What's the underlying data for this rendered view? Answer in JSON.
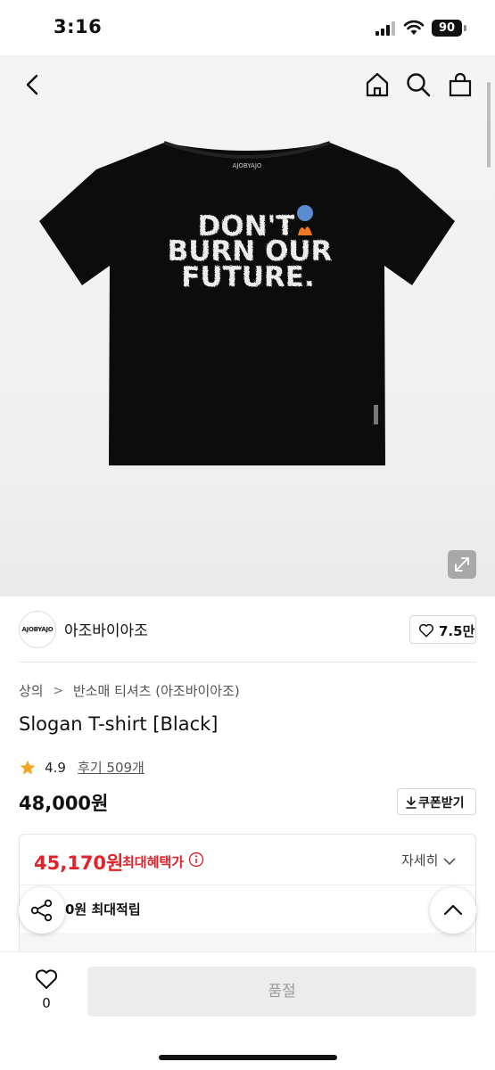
{
  "status_bar": {
    "time": "3:16",
    "battery": "90"
  },
  "nav": {
    "back_icon": "chevron-left-icon",
    "home_icon": "home-icon",
    "search_icon": "search-icon",
    "bag_icon": "shopping-bag-icon"
  },
  "product_image": {
    "label_tag": "AJOBYAJO",
    "slogan_lines": [
      "DON'T",
      "BURN OUR",
      "FUTURE."
    ],
    "expand_icon": "expand-icon"
  },
  "brand": {
    "logo_text": "AJOBYAJO",
    "name": "아조바이아조",
    "likes": "7.5만"
  },
  "breadcrumb": {
    "category": "상의",
    "subcategory": "반소매 티셔츠 (아조바이아조)"
  },
  "product": {
    "title": "Slogan T-shirt [Black]",
    "rating": "4.9",
    "review_link": "후기 509개",
    "price": "48,000원",
    "coupon_label": "쿠폰받기"
  },
  "benefit": {
    "max_benefit_price": "45,170원",
    "max_benefit_label": "최대혜택가",
    "detail_label": "자세히",
    "points_text": "0원 최대적립"
  },
  "bottom_bar": {
    "wish_count": "0",
    "buy_label": "품절"
  },
  "colors": {
    "accent_red": "#e0232b",
    "star": "#f5a623",
    "disabled_button": "#ececec"
  }
}
